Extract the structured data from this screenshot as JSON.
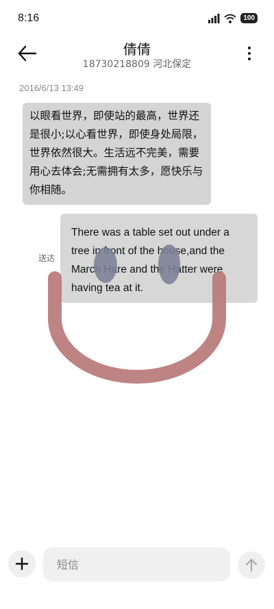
{
  "status_bar": {
    "time": "8:16",
    "battery": "100",
    "icons": [
      "signal-icon",
      "wifi-icon",
      "battery-icon"
    ]
  },
  "header": {
    "contact_name": "倩倩",
    "subtitle": "18730218809 河北保定",
    "back_icon": "back-arrow-icon",
    "more_icon": "more-vertical-icon"
  },
  "conversation": {
    "timestamp": "2016/6/13 13:49",
    "messages": [
      {
        "direction": "incoming",
        "text": "以眼看世界，即使站的最高，世界还是很小;以心看世界，即使身处局限，世界依然很大。生活远不完美，需要用心去体会;无需拥有太多，愿快乐与你相随。"
      },
      {
        "direction": "outgoing",
        "text": "There was a table set out under a tree in front of the house,and the March Hare and the Hatter were having tea at it.",
        "status": "送达"
      }
    ]
  },
  "composer": {
    "placeholder": "短信",
    "value": "",
    "add_icon": "plus-icon",
    "send_icon": "send-arrow-icon"
  },
  "colors": {
    "incoming_bubble": "#d4d4d4",
    "outgoing_bubble": "#d2d2d2",
    "doodle_mouth": "#b87a7a",
    "doodle_eyes": "#7b8196"
  }
}
